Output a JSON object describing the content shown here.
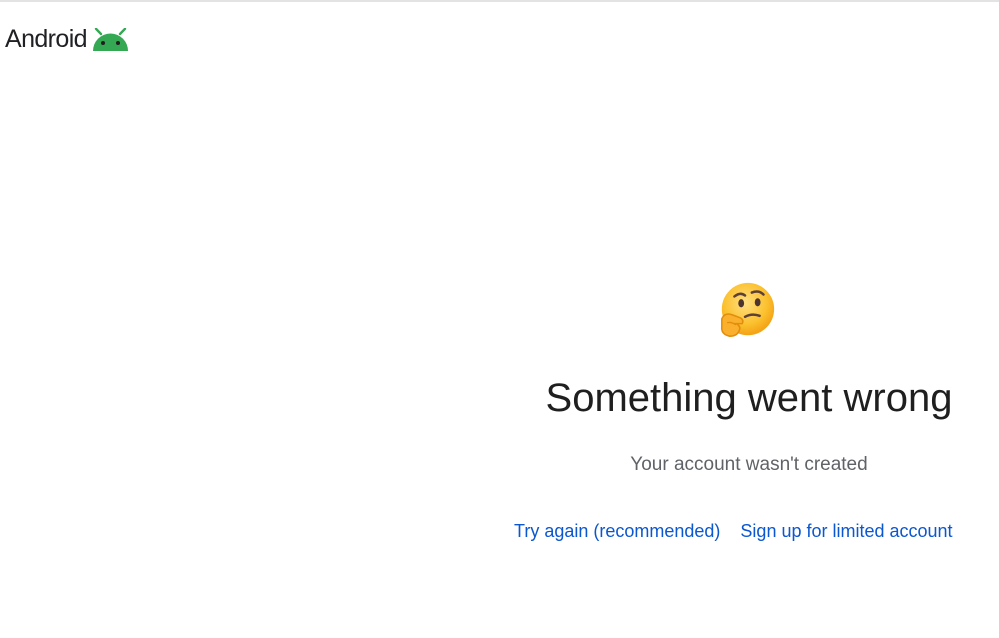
{
  "brand": {
    "name": "Android",
    "logo_icon": "android-robot-icon",
    "logo_color": "#34a853"
  },
  "error": {
    "emoji_icon": "thinking-face-icon",
    "title": "Something went wrong",
    "message": "Your account wasn't created"
  },
  "actions": {
    "try_again_label": "Try again (recommended)",
    "limited_account_label": "Sign up for limited account",
    "link_color": "#0b57d0"
  }
}
